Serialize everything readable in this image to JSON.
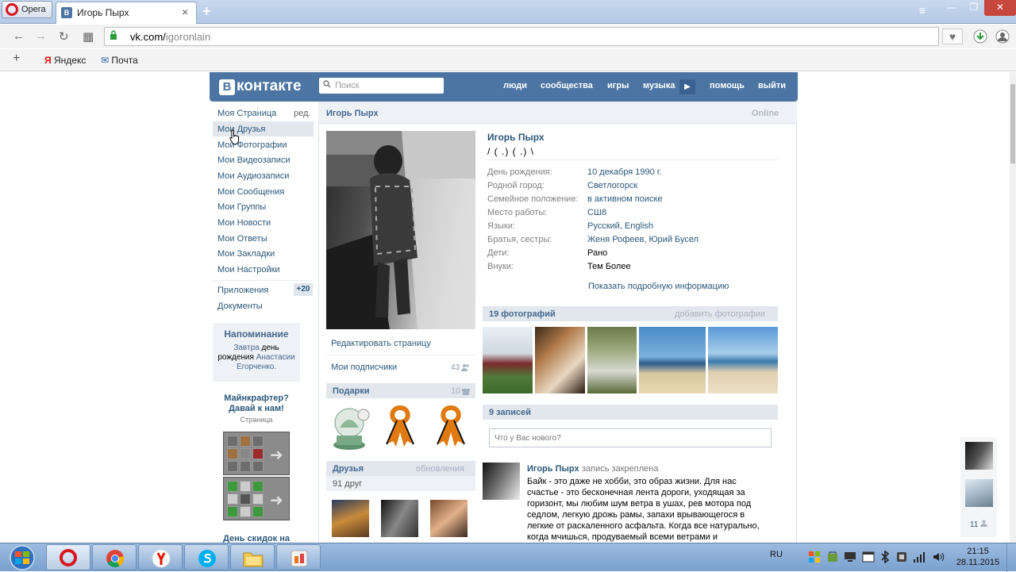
{
  "browser": {
    "opera_label": "Opera",
    "tab_title": "Игорь Пырх",
    "tab_favicon": "В",
    "close_glyph": "×",
    "newtab_glyph": "+",
    "menu_glyph": "≡",
    "min_glyph": "—",
    "max_glyph": "❐",
    "winclose_glyph": "✕",
    "url_domain": "vk.com/",
    "url_path": "igoronlain",
    "back_glyph": "←",
    "forward_glyph": "→",
    "reload_glyph": "↻",
    "grid_glyph": "▦",
    "heart_glyph": "♥",
    "add_glyph": "+",
    "bookmarks": [
      {
        "icon": "Я",
        "label": "Яндекс"
      },
      {
        "icon": "✉",
        "label": "Почта"
      }
    ],
    "accent": "#4c75a3"
  },
  "header": {
    "logo_letter": "В",
    "logo_text": "контакте",
    "search_placeholder": "Поиск",
    "nav": [
      "люди",
      "сообщества",
      "игры",
      "музыка",
      "помощь",
      "выйти"
    ],
    "play_glyph": "▶"
  },
  "left_menu": {
    "items": [
      "Моя Страница",
      "Мои Друзья",
      "Мои Фотографии",
      "Мои Видеозаписи",
      "Мои Аудиозаписи",
      "Мои Сообщения",
      "Мои Группы",
      "Мои Новости",
      "Мои Ответы",
      "Мои Закладки",
      "Мои Настройки"
    ],
    "edit_label": "ред.",
    "apps_label": "Приложения",
    "apps_badge": "+20",
    "docs_label": "Документы",
    "reminder": {
      "title": "Напоминание",
      "line_blue1": "Завтра ",
      "line_black1": "день рождения",
      "line_blue2": " Анастасии Егорченко."
    },
    "ad": {
      "title": "Майнкрафтер? Давай к нам!",
      "subtitle": "Страница",
      "bottom": "День скидок на"
    }
  },
  "profile": {
    "name_bar": "Игорь Пырх",
    "online": "Online",
    "name": "Игорь Пырх",
    "status": "/ ( .) ( .) \\",
    "fields": [
      {
        "label": "День рождения:",
        "value": "10 декабря 1990 г.",
        "link": true
      },
      {
        "label": "Родной город:",
        "value": "Светлогорск",
        "link": true
      },
      {
        "label": "Семейное положение:",
        "value": "в активном поиске",
        "link": true
      },
      {
        "label": "Место работы:",
        "value": "СШ8",
        "link": true
      },
      {
        "label": "Языки:",
        "value": "Русский, English",
        "link": true
      },
      {
        "label": "Братья, сестры:",
        "value": "Женя Рофеев, Юрий Бусел",
        "link": true
      },
      {
        "label": "Дети:",
        "value": "Рано",
        "link": false
      },
      {
        "label": "Внуки:",
        "value": "Тем Более",
        "link": false
      }
    ],
    "show_more": "Показать подробную информацию",
    "edit_page": "Редактировать страницу",
    "followers_label": "Мои подписчики",
    "followers_count": "43",
    "gifts_label": "Подарки",
    "gifts_count": "10",
    "friends_label": "Друзья",
    "friends_updates": "обновления",
    "friends_count": "91 друг",
    "photos_label": "19 фотографий",
    "add_photos": "добавить фотографии",
    "posts_label": "9 записей",
    "post_placeholder": "Что у Вас нового?",
    "post": {
      "author": "Игорь Пырх",
      "pinned": "запись закреплена",
      "text": "Байк - это даже не хобби, это образ жизни. Для нас счастье - это бесконечная лента дороги, уходящая за горизонт, мы любим шум ветра в ушах, рев мотора под седлом, легкую дрожь рамы, запахи врывающегося в легкие от раскаленного асфальта. Когда все натурально, когда мчишься, продуваемый всеми ветрами и чувствуешь весь мир каждой"
    }
  },
  "side_float": {
    "count": "11"
  },
  "taskbar": {
    "lang": "RU",
    "time": "21:15",
    "date": "28.11.2015",
    "apps": [
      "opera",
      "chrome",
      "yandex",
      "skype",
      "explorer",
      "paint"
    ]
  }
}
